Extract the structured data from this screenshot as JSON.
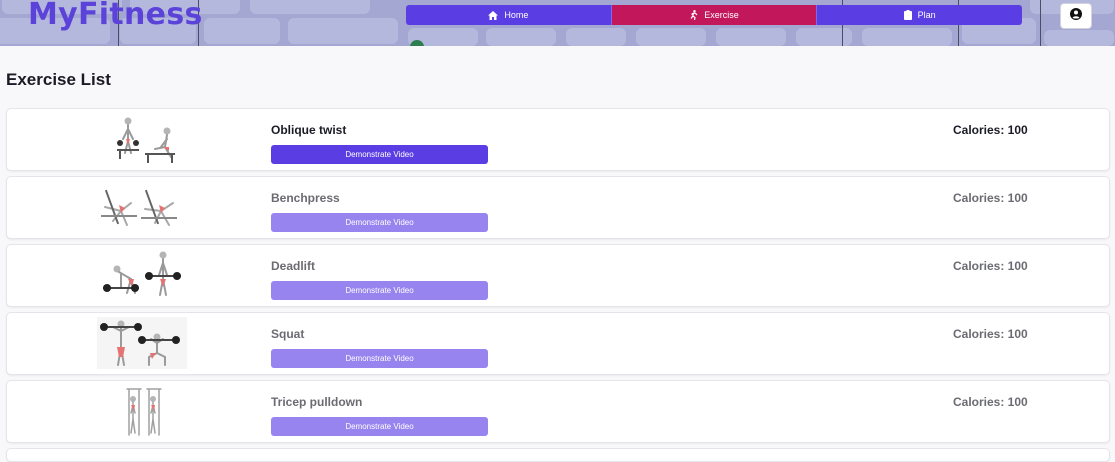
{
  "header": {
    "logo": "MyFitness",
    "nav": [
      {
        "label": "Home",
        "icon": "home-icon",
        "active": false
      },
      {
        "label": "Exercise",
        "icon": "running-icon",
        "active": true
      },
      {
        "label": "Plan",
        "icon": "clipboard-icon",
        "active": false
      }
    ],
    "user_icon": "user-circle-icon"
  },
  "colors": {
    "primary": "#5a3ee3",
    "active": "#c2185b",
    "button_faded": "#9784ef"
  },
  "page": {
    "title": "Exercise List"
  },
  "exercises": [
    {
      "name": "Oblique twist",
      "button": "Demonstrate Video",
      "calories": "Calories: 100"
    },
    {
      "name": "Benchpress",
      "button": "Demonstrate Video",
      "calories": "Calories: 100"
    },
    {
      "name": "Deadlift",
      "button": "Demonstrate Video",
      "calories": "Calories: 100"
    },
    {
      "name": "Squat",
      "button": "Demonstrate Video",
      "calories": "Calories: 100"
    },
    {
      "name": "Tricep pulldown",
      "button": "Demonstrate Video",
      "calories": "Calories: 100"
    }
  ]
}
